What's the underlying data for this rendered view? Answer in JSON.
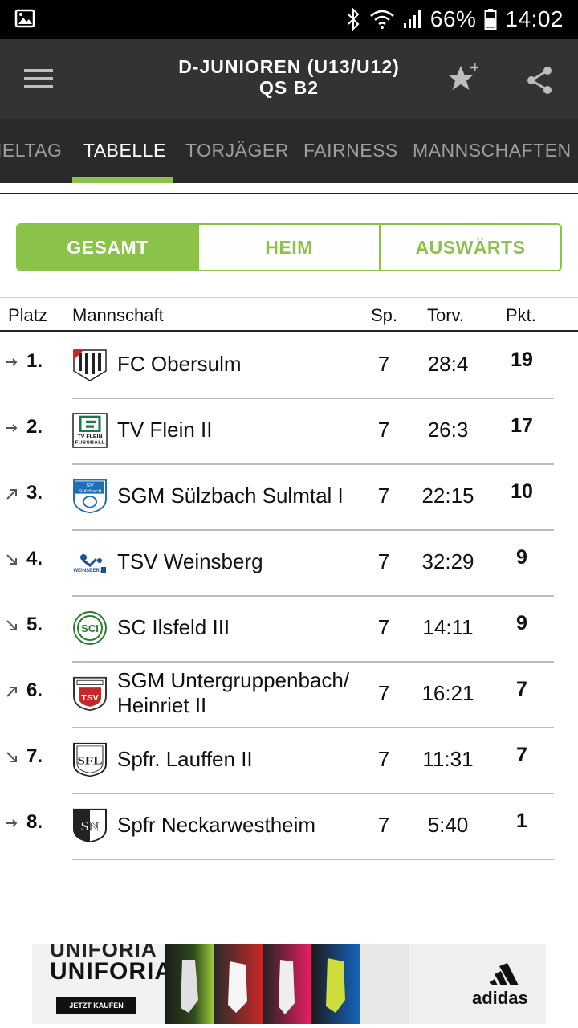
{
  "status_bar": {
    "battery": "66%",
    "time": "14:02"
  },
  "header": {
    "title_line1": "D-JUNIOREN (U13/U12)",
    "title_line2": "QS B2"
  },
  "tabs": [
    "IELTAG",
    "TABELLE",
    "TORJÄGER",
    "FAIRNESS",
    "MANNSCHAFTEN"
  ],
  "active_tab": "TABELLE",
  "segments": [
    "GESAMT",
    "HEIM",
    "AUSWÄRTS"
  ],
  "active_segment": "GESAMT",
  "table": {
    "headers": {
      "platz": "Platz",
      "mannschaft": "Mannschaft",
      "sp": "Sp.",
      "torv": "Torv.",
      "pkt": "Pkt."
    },
    "rows": [
      {
        "rank": "1.",
        "trend": "same",
        "team": "FC Obersulm",
        "sp": "7",
        "torv": "28:4",
        "pkt": "19",
        "logo": "fc-obersulm-crest"
      },
      {
        "rank": "2.",
        "trend": "same",
        "team": "TV Flein II",
        "sp": "7",
        "torv": "26:3",
        "pkt": "17",
        "logo": "tv-flein-crest",
        "logo_text": "TV FLEIN FUSSBALL"
      },
      {
        "rank": "3.",
        "trend": "up",
        "team": "SGM Sülzbach Sulmtal I",
        "sp": "7",
        "torv": "22:15",
        "pkt": "10",
        "logo": "sv-sulzbach-crest",
        "logo_text": "SV Sülzbach"
      },
      {
        "rank": "4.",
        "trend": "down",
        "team": "TSV Weinsberg",
        "sp": "7",
        "torv": "32:29",
        "pkt": "9",
        "logo": "tsv-weinsberg-crest",
        "logo_text": "WEINSBERG"
      },
      {
        "rank": "5.",
        "trend": "down",
        "team": "SC Ilsfeld III",
        "sp": "7",
        "torv": "14:11",
        "pkt": "9",
        "logo": "sc-ilsfeld-crest",
        "logo_text": "SCI"
      },
      {
        "rank": "6.",
        "trend": "up",
        "team_line1": "SGM Untergruppenbach/",
        "team_line2": "Heinriet II",
        "sp": "7",
        "torv": "16:21",
        "pkt": "7",
        "logo": "tsv-untergruppenbach-crest",
        "logo_text": "TSV"
      },
      {
        "rank": "7.",
        "trend": "down",
        "team": "Spfr. Lauffen II",
        "sp": "7",
        "torv": "11:31",
        "pkt": "7",
        "logo": "spfr-lauffen-crest",
        "logo_text": "SFL"
      },
      {
        "rank": "8.",
        "trend": "same",
        "team": "Spfr Neckarwestheim",
        "sp": "7",
        "torv": "5:40",
        "pkt": "1",
        "logo": "spfr-neckarwestheim-crest",
        "logo_text": "SN"
      }
    ]
  },
  "ad": {
    "brand1": "UNIFORIA",
    "brand2": "UNIFORIA",
    "cta": "JETZT KAUFEN",
    "advertiser": "adidas"
  },
  "colors": {
    "accent": "#8bc34a",
    "header_bg": "#333333",
    "tabs_bg": "#2a2a2a",
    "statusbar_bg": "#000000"
  }
}
